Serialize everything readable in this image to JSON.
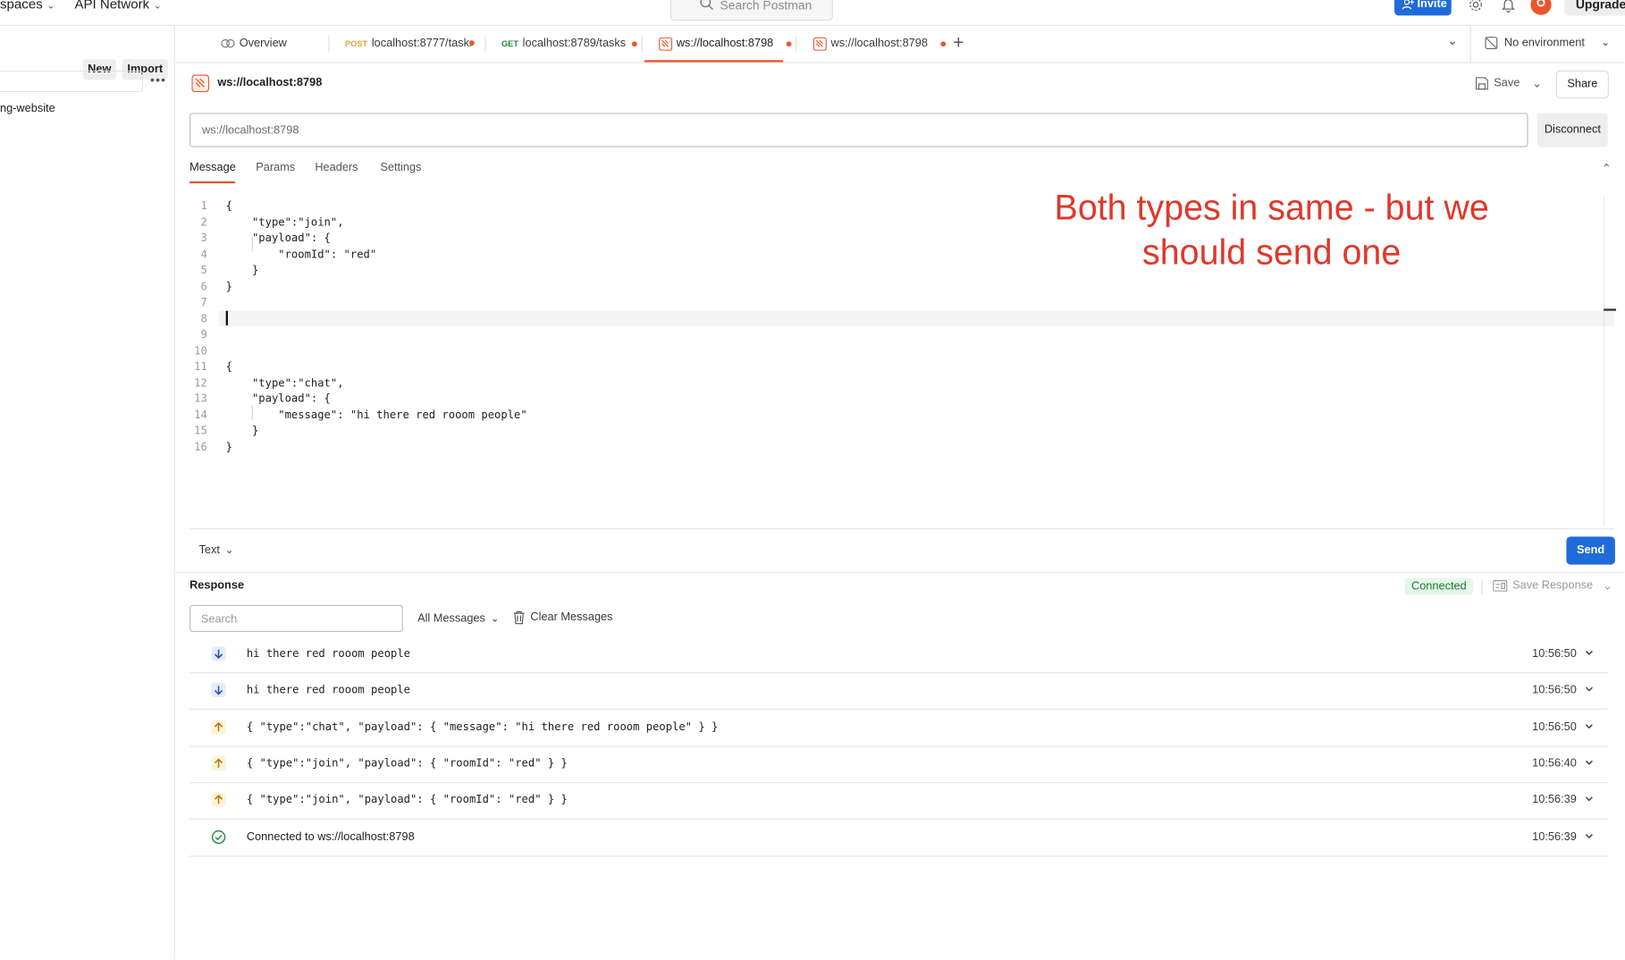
{
  "topbar": {
    "workspaces": "spaces",
    "api_network": "API Network",
    "search_placeholder": "Search Postman",
    "invite": "Invite",
    "upgrade": "Upgrade"
  },
  "sidebar": {
    "new": "New",
    "import": "Import",
    "collection_item": "ng-website"
  },
  "tabs": [
    {
      "label": "Overview"
    },
    {
      "method": "POST",
      "label": "localhost:8777/tasks",
      "method_color": "#e8a13a"
    },
    {
      "method": "GET",
      "label": "localhost:8789/tasks",
      "method_color": "#1b8a3a"
    },
    {
      "label": "ws://localhost:8798",
      "active": true
    },
    {
      "label": "ws://localhost:8798"
    }
  ],
  "environment": "No environment",
  "request": {
    "title": "ws://localhost:8798",
    "save": "Save",
    "share": "Share",
    "url_value": "ws://localhost:8798",
    "disconnect": "Disconnect",
    "subtabs": [
      "Message",
      "Params",
      "Headers",
      "Settings"
    ]
  },
  "editor": {
    "lines": [
      "{",
      "    \"type\":\"join\",",
      "    \"payload\": {",
      "        \"roomId\": \"red\"",
      "    }",
      "}",
      "",
      "",
      "",
      "",
      "{",
      "    \"type\":\"chat\",",
      "    \"payload\": {",
      "        \"message\": \"hi there red rooom people\"",
      "    }",
      "}"
    ],
    "line_numbers": [
      "1",
      "2",
      "3",
      "4",
      "5",
      "6",
      "7",
      "8",
      "9",
      "10",
      "11",
      "12",
      "13",
      "14",
      "15",
      "16"
    ],
    "format": "Text",
    "send": "Send"
  },
  "annotation": {
    "line1": "Both types in same - but we",
    "line2": "should send one",
    "color": "#e0382a"
  },
  "response": {
    "title": "Response",
    "status": "Connected",
    "save_response": "Save Response",
    "search_placeholder": "Search",
    "filter": "All Messages",
    "clear": "Clear Messages",
    "messages": [
      {
        "direction": "incoming",
        "text": "hi there red rooom people",
        "time": "10:56:50"
      },
      {
        "direction": "incoming",
        "text": "hi there red rooom people",
        "time": "10:56:50"
      },
      {
        "direction": "outgoing",
        "text": "{ \"type\":\"chat\", \"payload\": { \"message\": \"hi there red rooom people\" } }",
        "time": "10:56:50"
      },
      {
        "direction": "outgoing",
        "text": "{ \"type\":\"join\", \"payload\": { \"roomId\": \"red\" } }",
        "time": "10:56:40"
      },
      {
        "direction": "outgoing",
        "text": "{ \"type\":\"join\", \"payload\": { \"roomId\": \"red\" } }",
        "time": "10:56:39"
      },
      {
        "direction": "status",
        "text": "Connected to ws://localhost:8798",
        "time": "10:56:39"
      }
    ]
  },
  "colors": {
    "accent": "#e8562a",
    "primary_button": "#1f6bd9",
    "connected_green": "#1b7a38"
  }
}
